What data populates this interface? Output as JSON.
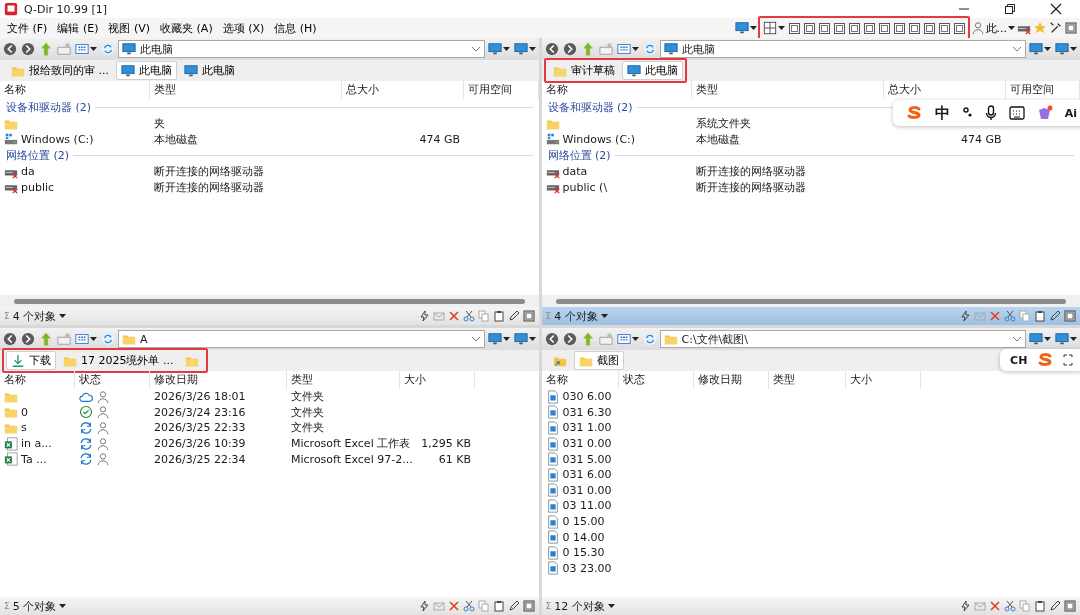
{
  "window": {
    "title": "Q-Dir 10.99 [1]"
  },
  "menu": [
    "文件 (F)",
    "编辑 (E)",
    "视图 (V)",
    "收藏夹 (A)",
    "选项 (X)",
    "信息 (H)"
  ],
  "toolbar": {
    "more_label": "此...",
    "layouts_highlighted": true
  },
  "panes": [
    {
      "active": false,
      "tabs_highlighted": false,
      "address": {
        "kind": "computer",
        "text": "此电脑"
      },
      "tabs": [
        {
          "kind": "folder",
          "label": "报给致同的审 ...",
          "selected": false
        },
        {
          "kind": "computer",
          "label": "此电脑",
          "selected": true
        },
        {
          "kind": "computer",
          "label": "此电脑",
          "selected": false
        }
      ],
      "columns": [
        {
          "kind": "name",
          "label": "名称"
        },
        {
          "kind": "type",
          "label": "类型"
        },
        {
          "kind": "size",
          "label": "总大小"
        },
        {
          "kind": "free",
          "label": "可用空间"
        }
      ],
      "groups": [
        {
          "label": "设备和驱动器 (2)",
          "rows": [
            {
              "kind": "folder",
              "type": "夹"
            },
            {
              "kind": "drive",
              "name": "Windows (C:)",
              "type": "本地磁盘",
              "size": "474 GB"
            }
          ]
        },
        {
          "label": "网络位置 (2)",
          "rows": [
            {
              "kind": "network-drive",
              "name": "da",
              "type": "断开连接的网络驱动器"
            },
            {
              "kind": "network-drive",
              "name": "public",
              "type": "断开连接的网络驱动器"
            }
          ]
        }
      ],
      "status": {
        "sigma": "Σ",
        "count": "4 个对象"
      }
    },
    {
      "active": true,
      "tabs_highlighted": true,
      "address": {
        "kind": "computer",
        "text": "此电脑"
      },
      "tabs": [
        {
          "kind": "folder",
          "label": "审计草稿",
          "selected": false
        },
        {
          "kind": "computer",
          "label": "此电脑",
          "selected": true
        }
      ],
      "columns": [
        {
          "kind": "name",
          "label": "名称"
        },
        {
          "kind": "type",
          "label": "类型"
        },
        {
          "kind": "size",
          "label": "总大小"
        },
        {
          "kind": "free",
          "label": "可用空间"
        }
      ],
      "groups": [
        {
          "label": "设备和驱动器 (2)",
          "rows": [
            {
              "kind": "folder",
              "type": "系统文件夹"
            },
            {
              "kind": "drive",
              "name": "Windows (C:)",
              "type": "本地磁盘",
              "size": "474 GB"
            }
          ]
        },
        {
          "label": "网络位置 (2)",
          "rows": [
            {
              "kind": "network-drive",
              "name": "data",
              "type": "断开连接的网络驱动器"
            },
            {
              "kind": "network-drive",
              "name": "public (\\",
              "type": "断开连接的网络驱动器"
            }
          ]
        }
      ],
      "status": {
        "sigma": "Σ",
        "count": "4 个对象"
      }
    },
    {
      "active": false,
      "tabs_highlighted": true,
      "address": {
        "kind": "folder",
        "text": "A"
      },
      "tabs": [
        {
          "kind": "download",
          "label": "下载",
          "selected": true
        },
        {
          "kind": "folder",
          "label": "17 2025境外单 ...",
          "selected": false
        },
        {
          "kind": "folder",
          "selected": false
        }
      ],
      "columns": [
        {
          "kind": "name",
          "label": "名称"
        },
        {
          "kind": "status",
          "label": "状态"
        },
        {
          "kind": "date",
          "label": "修改日期"
        },
        {
          "kind": "type",
          "label": "类型"
        },
        {
          "kind": "size",
          "label": "大小"
        }
      ],
      "rows": [
        {
          "kind": "folder",
          "status": {
            "kind": "cloud"
          },
          "date": "2026/3/26 18:01",
          "type": "文件夹"
        },
        {
          "kind": "folder",
          "name": "0",
          "status": {
            "kind": "synced"
          },
          "date": "2026/3/24 23:16",
          "type": "文件夹"
        },
        {
          "kind": "folder",
          "name": "s",
          "status": {
            "kind": "syncing"
          },
          "date": "2026/3/25 22:33",
          "type": "文件夹"
        },
        {
          "kind": "spreadsheet",
          "name": "in a...",
          "status": {
            "kind": "syncing"
          },
          "date": "2026/3/26 10:39",
          "type": "Microsoft Excel 工作表",
          "size": "1,295 KB"
        },
        {
          "kind": "spreadsheet",
          "name": "Ta ...",
          "status": {
            "kind": "syncing"
          },
          "date": "2026/3/25 22:34",
          "type": "Microsoft Excel 97-2...",
          "size": "61 KB"
        }
      ],
      "status": {
        "sigma": "Σ",
        "count": "5 个对象"
      }
    },
    {
      "active": false,
      "tabs_highlighted": false,
      "address": {
        "kind": "folder",
        "text": "C:\\文件\\截图\\"
      },
      "tabs": [
        {
          "kind": "shortcut",
          "selected": false
        },
        {
          "kind": "folder",
          "label": "截图",
          "selected": true
        }
      ],
      "columns": [
        {
          "kind": "name",
          "label": "名称"
        },
        {
          "kind": "status",
          "label": "状态"
        },
        {
          "kind": "date",
          "label": "修改日期"
        },
        {
          "kind": "type",
          "label": "类型"
        },
        {
          "kind": "size",
          "label": "大小"
        }
      ],
      "rows": [
        {
          "kind": "image",
          "name": "030 6.00"
        },
        {
          "kind": "image",
          "name": "031 6.30"
        },
        {
          "kind": "image",
          "name": "031 1.00"
        },
        {
          "kind": "image",
          "name": "031 0.00"
        },
        {
          "kind": "image",
          "name": "031 5.00"
        },
        {
          "kind": "image",
          "name": "031 6.00"
        },
        {
          "kind": "image",
          "name": "031 0.00"
        },
        {
          "kind": "image",
          "name": "03 11.00"
        },
        {
          "kind": "image",
          "name": "0 15.00"
        },
        {
          "kind": "image",
          "name": "0 14.00"
        },
        {
          "kind": "image",
          "name": "0 15.30"
        },
        {
          "kind": "image",
          "name": "03 23.00"
        }
      ],
      "status": {
        "sigma": "Σ",
        "count": "12 个对象"
      }
    }
  ],
  "ime_bars": [
    {
      "items": [
        {
          "kind": "logo"
        },
        {
          "kind": "text",
          "text": "中"
        },
        {
          "kind": "punct"
        },
        {
          "kind": "mic"
        },
        {
          "kind": "keyboard"
        },
        {
          "kind": "skin"
        },
        {
          "kind": "text",
          "text": "Ai"
        }
      ]
    },
    {
      "items": [
        {
          "kind": "text",
          "text": "CH"
        },
        {
          "kind": "logo"
        },
        {
          "kind": "expand"
        }
      ]
    }
  ]
}
